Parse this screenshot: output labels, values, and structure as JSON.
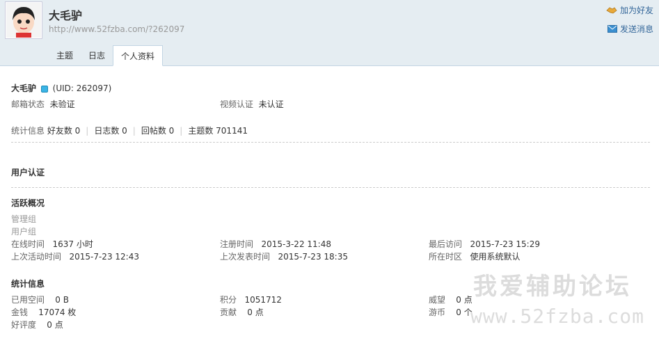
{
  "header": {
    "username": "大毛驴",
    "url": "http://www.52fzba.com/?262097",
    "add_friend": "加为好友",
    "send_message": "发送消息",
    "tabs": [
      "主题",
      "日志",
      "个人资料"
    ]
  },
  "profile": {
    "name": "大毛驴",
    "uid": "(UID: 262097)",
    "email_label": "邮箱状态",
    "email_value": "未验证",
    "video_label": "视频认证",
    "video_value": "未认证",
    "stats_label": "统计信息",
    "friends": "好友数 0",
    "blogs": "日志数 0",
    "replies": "回帖数 0",
    "threads": "主题数 701141"
  },
  "sections": {
    "auth_title": "用户认证",
    "activity_title": "活跃概况",
    "admin_group": "管理组",
    "user_group": "用户组",
    "stats_title": "统计信息"
  },
  "activity": {
    "online_label": "在线时间",
    "online_value": "1637 小时",
    "reg_label": "注册时间",
    "reg_value": "2015-3-22 11:48",
    "last_visit_label": "最后访问",
    "last_visit_value": "2015-7-23 15:29",
    "last_active_label": "上次活动时间",
    "last_active_value": "2015-7-23 12:43",
    "last_post_label": "上次发表时间",
    "last_post_value": "2015-7-23 18:35",
    "tz_label": "所在时区",
    "tz_value": "使用系统默认"
  },
  "stats": {
    "space_label": "已用空间",
    "space_value": "0 B",
    "points_label": "积分",
    "points_value": "1051712",
    "prestige_label": "威望",
    "prestige_value": "0 点",
    "money_label": "金钱",
    "money_value": "17074 枚",
    "contrib_label": "贡献",
    "contrib_value": "0 点",
    "coin_label": "游币",
    "coin_value": "0 个",
    "rating_label": "好评度",
    "rating_value": "0 点"
  },
  "watermark": {
    "line1": "我爱辅助论坛",
    "line2": "www.52fzba.com"
  },
  "icons": {
    "avatar": "avatar-image",
    "add_friend": "handshake-icon",
    "send_message": "envelope-icon",
    "online_status": "online-dot-icon"
  },
  "colors": {
    "header_bg": "#e5edf2",
    "link": "#336699"
  }
}
